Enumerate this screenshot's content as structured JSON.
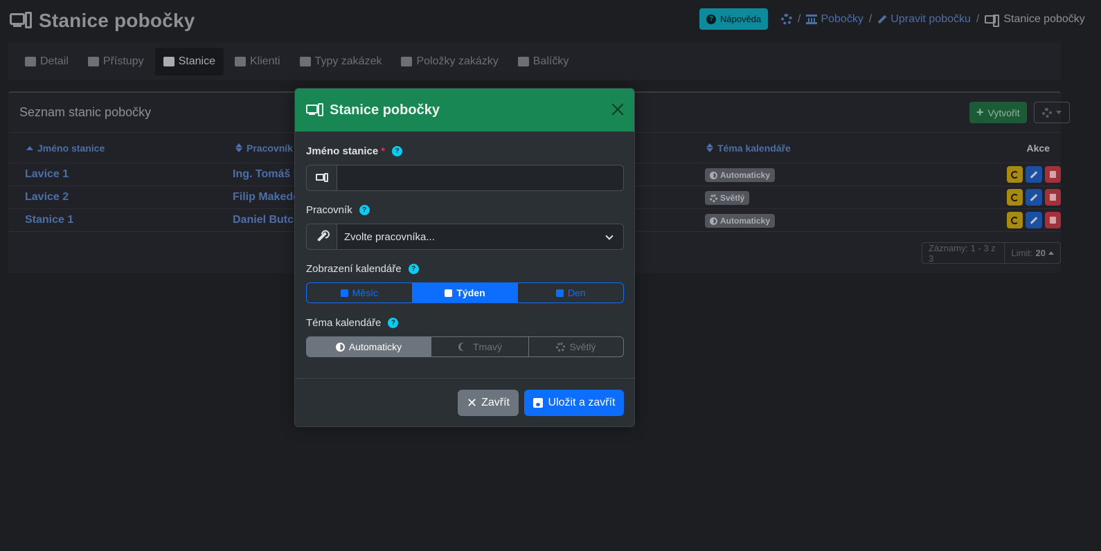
{
  "page": {
    "title": "Stanice pobočky",
    "help_label": "Nápověda"
  },
  "breadcrumb": {
    "items": [
      "Pobočky",
      "Upravit pobočku"
    ],
    "current": "Stanice pobočky"
  },
  "tabs": [
    {
      "label": "Detail",
      "icon": "bank-icon"
    },
    {
      "label": "Přístupy",
      "icon": "users-icon"
    },
    {
      "label": "Stanice",
      "icon": "computer-icon",
      "active": true
    },
    {
      "label": "Klienti",
      "icon": "user-icon"
    },
    {
      "label": "Typy zakázek",
      "icon": "cubes-icon"
    },
    {
      "label": "Položky zakázky",
      "icon": "cogs-icon"
    },
    {
      "label": "Balíčky",
      "icon": "box-icon"
    }
  ],
  "card": {
    "title": "Seznam stanic pobočky",
    "create_label": "Vytvořit"
  },
  "table": {
    "columns": {
      "name": "Jméno stanice",
      "worker": "Pracovník",
      "theme": "Téma kalendáře",
      "actions": "Akce"
    },
    "rows": [
      {
        "name": "Lavice 1",
        "worker": "Ing. Tomáš I",
        "theme": "Automaticky",
        "theme_icon": "half-circle-icon"
      },
      {
        "name": "Lavice 2",
        "worker": "Filip Makedo",
        "theme": "Světlý",
        "theme_icon": "sun-icon"
      },
      {
        "name": "Stanice 1",
        "worker": "Daniel Butch",
        "theme": "Automaticky",
        "theme_icon": "half-circle-icon"
      }
    ]
  },
  "pager": {
    "records": "Záznamy: 1 - 3 z 3",
    "limit_label": "Limit:",
    "limit_value": "20"
  },
  "modal": {
    "title": "Stanice pobočky",
    "fields": {
      "name_label": "Jméno stanice",
      "name_required": "*",
      "name_value": "",
      "worker_label": "Pracovník",
      "worker_placeholder": "Zvolte pracovníka...",
      "view_label": "Zobrazení kalendáře",
      "view_options": [
        "Měsíc",
        "Týden",
        "Den"
      ],
      "view_selected": "Týden",
      "theme_label": "Téma kalendáře",
      "theme_options": [
        "Automaticky",
        "Tmavý",
        "Světlý"
      ],
      "theme_selected": "Automaticky"
    },
    "close_label": "Zavřít",
    "save_label": "Uložit a zavřít"
  },
  "colors": {
    "modal_header": "#198754",
    "primary": "#0d6efd",
    "info": "#0dcaf0",
    "danger": "#dc3545"
  }
}
